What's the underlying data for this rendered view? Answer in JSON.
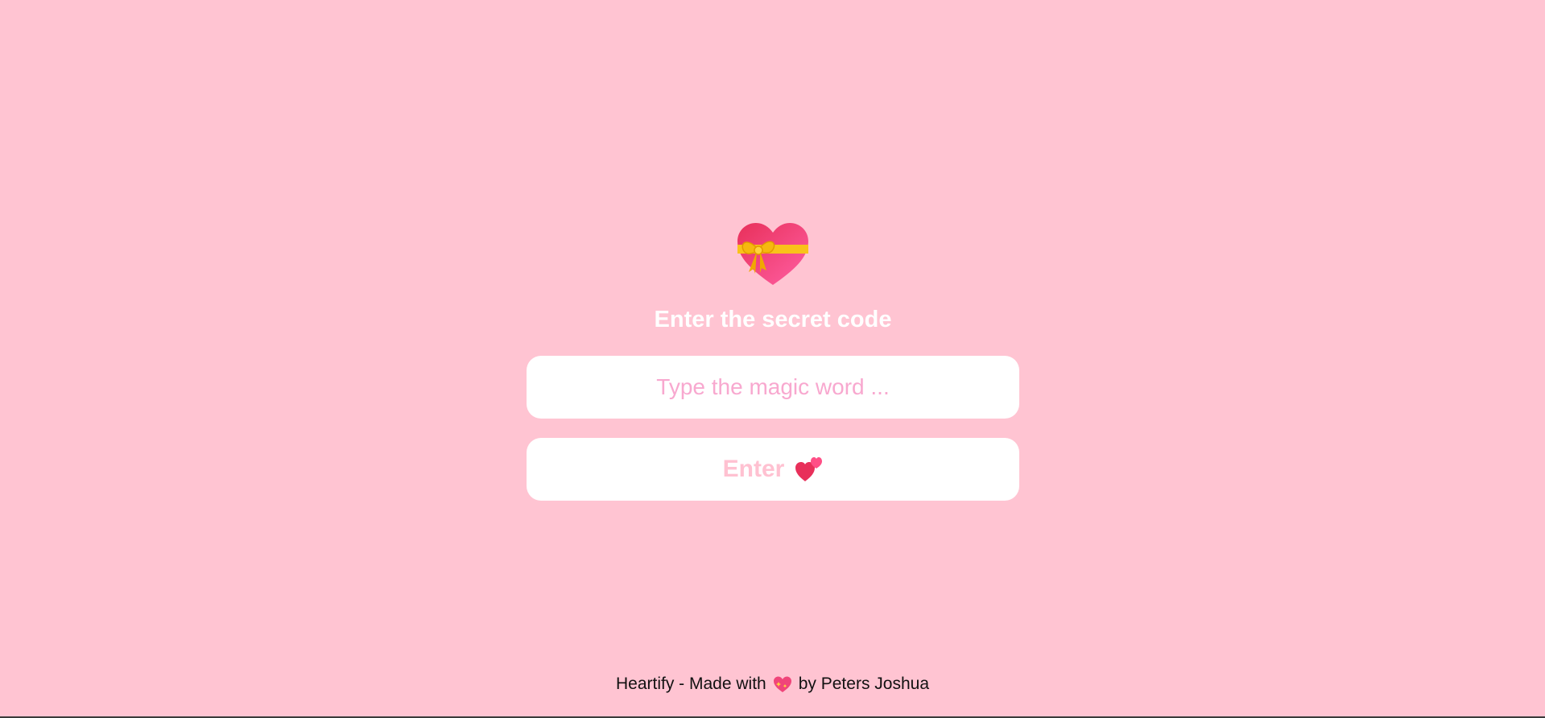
{
  "main": {
    "icon": "heart-with-ribbon-icon",
    "heading": "Enter the secret code",
    "input": {
      "value": "",
      "placeholder": "Type the magic word ..."
    },
    "enter_button": {
      "label": "Enter",
      "icon": "two-hearts-icon"
    }
  },
  "footer": {
    "text_before": "Heartify - Made with",
    "icon": "heart-with-sparkles-icon",
    "text_after": "by Peters Joshua"
  },
  "colors": {
    "background": "#ffc4d2",
    "surface": "#ffffff",
    "placeholder": "#f8a8cf",
    "button_text": "#ffc1d1",
    "heart_red": "#e8305a",
    "heart_pink": "#ff5fa3",
    "ribbon_gold": "#f9c21a"
  }
}
